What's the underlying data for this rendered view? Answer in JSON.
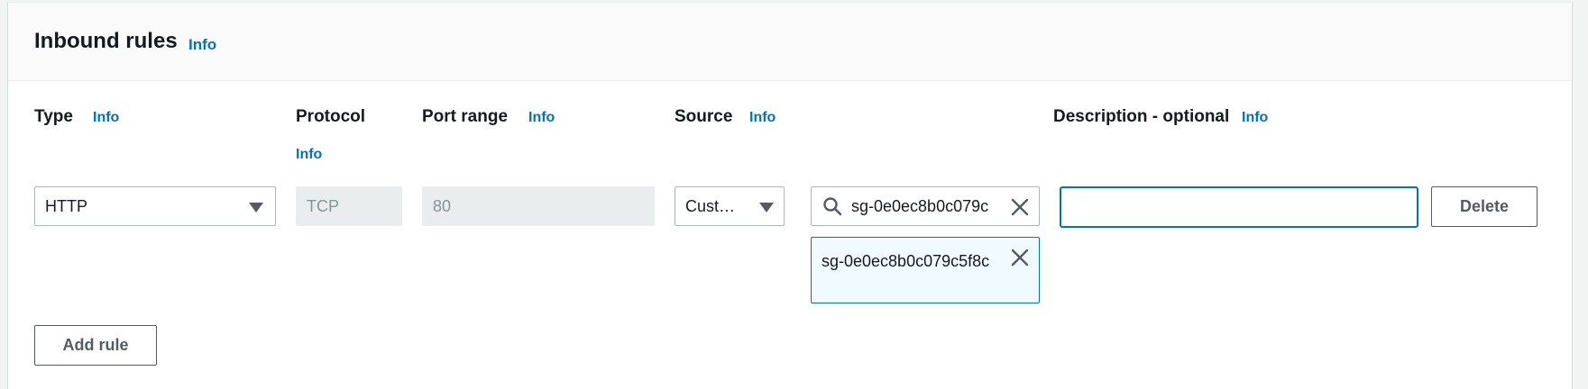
{
  "panel": {
    "title": "Inbound rules",
    "info": "Info"
  },
  "columns": {
    "type": {
      "label": "Type",
      "info": "Info"
    },
    "protocol": {
      "label": "Protocol",
      "info": "Info"
    },
    "port_range": {
      "label": "Port range",
      "info": "Info"
    },
    "source": {
      "label": "Source",
      "info": "Info"
    },
    "description": {
      "label": "Description - optional",
      "info": "Info"
    }
  },
  "rule": {
    "type_value": "HTTP",
    "protocol_value": "TCP",
    "port_value": "80",
    "source_type_value": "Cust…",
    "source_search_value": "sg-0e0ec8b0c079c",
    "selected_token": "sg-0e0ec8b0c079c5f8c",
    "description_value": "",
    "delete_label": "Delete"
  },
  "actions": {
    "add_rule_label": "Add rule"
  },
  "icons": {
    "type_caret": "caret-down-icon",
    "source_caret": "caret-down-icon",
    "search": "search-icon",
    "clear": "close-icon",
    "token_remove": "close-icon"
  },
  "colors": {
    "link": "#0073bb",
    "focus_border": "#0073bb",
    "token_bg": "#f1faff",
    "disabled_bg": "#eaeded"
  }
}
